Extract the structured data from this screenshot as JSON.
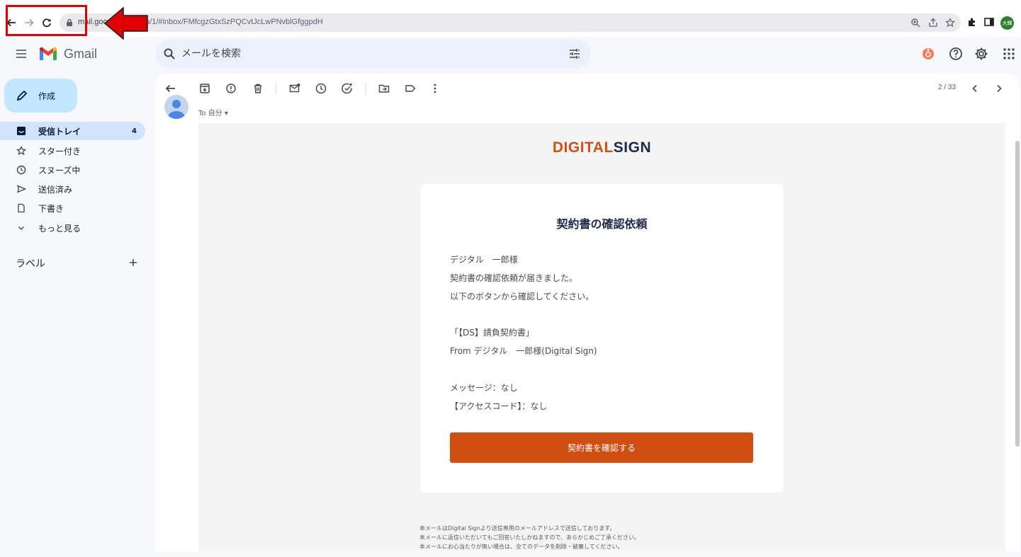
{
  "browser": {
    "url_host": "mail.goo",
    "url_path": "l/u/1/#inbox/FMfcgzGtxSzPQCvtJcLwPNvblGfggpdH",
    "profile_initials": "大輝",
    "icons": [
      "back-icon",
      "forward-icon",
      "reload-icon",
      "lock-icon",
      "zoom-icon",
      "share-icon",
      "bookmark-star-icon",
      "extensions-icon",
      "side-panel-icon"
    ]
  },
  "annotation": {
    "highlight_color": "#e00000",
    "arrow_color": "#e00000"
  },
  "gmail": {
    "brand": "Gmail",
    "search_placeholder": "メールを検索",
    "sidebar": {
      "compose_label": "作成",
      "items": [
        {
          "label": "受信トレイ",
          "count": "4",
          "icon": "inbox-icon",
          "active": true
        },
        {
          "label": "スター付き",
          "count": "",
          "icon": "star-icon",
          "active": false
        },
        {
          "label": "スヌーズ中",
          "count": "",
          "icon": "clock-icon",
          "active": false
        },
        {
          "label": "送信済み",
          "count": "",
          "icon": "send-icon",
          "active": false
        },
        {
          "label": "下書き",
          "count": "",
          "icon": "draft-icon",
          "active": false
        },
        {
          "label": "もっと見る",
          "count": "",
          "icon": "chevron-down-icon",
          "active": false
        }
      ],
      "labels_heading": "ラベル"
    },
    "toolbar": {
      "pager": "2 / 33",
      "icons": [
        "back-arrow-icon",
        "archive-icon",
        "report-spam-icon",
        "delete-icon",
        "mark-unread-icon",
        "snooze-icon",
        "add-task-icon",
        "move-to-icon",
        "label-icon",
        "more-vert-icon",
        "newer-icon",
        "older-icon"
      ]
    },
    "message": {
      "recipient": "To 自分"
    }
  },
  "email": {
    "logo_part1": "DIGITAL",
    "logo_part2": "SIGN",
    "brand_colors": {
      "orange": "#d14e12",
      "navy": "#1e2a4a"
    },
    "title": "契約書の確認依頼",
    "lines": [
      "デジタル　一郎様",
      "契約書の確認依頼が届きました。",
      "以下のボタンから確認してください。",
      "「【DS】請負契約書」",
      "From デジタル　一郎様(Digital Sign)",
      "メッセージ：なし",
      "【アクセスコード】：なし"
    ],
    "button_label": "契約書を確認する",
    "footer": [
      "本メールはDigital Signより送信専用のメールアドレスで送信しております。",
      "本メールに返信いただいてもご回答いたしかねますので、あらかじめご了承ください。",
      "本メールにお心当たりが無い場合は、全てのデータを削除・破棄してください。"
    ]
  }
}
